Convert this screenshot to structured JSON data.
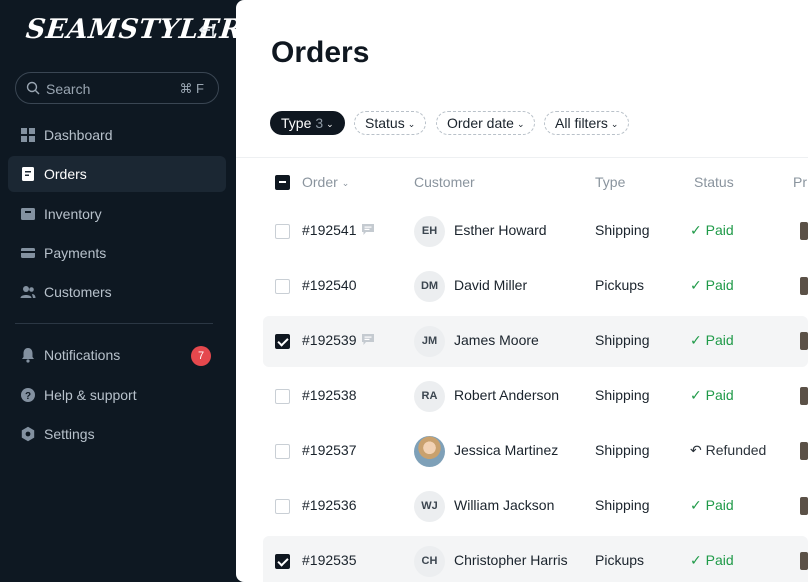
{
  "brand": {
    "logo": "SEAMSTYLERS"
  },
  "search": {
    "placeholder": "Search",
    "shortcut": "⌘ F"
  },
  "sidebar": {
    "items": [
      {
        "label": "Dashboard",
        "icon": "grid-icon"
      },
      {
        "label": "Orders",
        "icon": "receipt-icon",
        "active": true
      },
      {
        "label": "Inventory",
        "icon": "box-icon"
      },
      {
        "label": "Payments",
        "icon": "card-icon"
      },
      {
        "label": "Customers",
        "icon": "users-icon"
      }
    ],
    "secondary": [
      {
        "label": "Notifications",
        "icon": "bell-icon",
        "badge": "7"
      },
      {
        "label": "Help & support",
        "icon": "help-icon"
      },
      {
        "label": "Settings",
        "icon": "gear-icon"
      }
    ]
  },
  "main": {
    "title": "Orders",
    "filters": {
      "type": {
        "label": "Type",
        "count": "3"
      },
      "status": "Status",
      "order_date": "Order date",
      "all": "All filters"
    },
    "columns": {
      "order": "Order",
      "customer": "Customer",
      "type": "Type",
      "status": "Status",
      "extra": "Pr"
    },
    "rows": [
      {
        "id": "#192541",
        "initials": "EH",
        "name": "Esther Howard",
        "type": "Shipping",
        "status": "Paid",
        "status_icon": "✓",
        "checked": false,
        "has_note": true,
        "selected": false
      },
      {
        "id": "#192540",
        "initials": "DM",
        "name": "David Miller",
        "type": "Pickups",
        "status": "Paid",
        "status_icon": "✓",
        "checked": false,
        "has_note": false,
        "selected": false
      },
      {
        "id": "#192539",
        "initials": "JM",
        "name": "James Moore",
        "type": "Shipping",
        "status": "Paid",
        "status_icon": "✓",
        "checked": true,
        "has_note": true,
        "selected": true
      },
      {
        "id": "#192538",
        "initials": "RA",
        "name": "Robert Anderson",
        "type": "Shipping",
        "status": "Paid",
        "status_icon": "✓",
        "checked": false,
        "has_note": false,
        "selected": false
      },
      {
        "id": "#192537",
        "initials": "",
        "name": "Jessica Martinez",
        "type": "Shipping",
        "status": "Refunded",
        "status_icon": "↶",
        "checked": false,
        "has_note": false,
        "selected": false,
        "photo": true
      },
      {
        "id": "#192536",
        "initials": "WJ",
        "name": "William Jackson",
        "type": "Shipping",
        "status": "Paid",
        "status_icon": "✓",
        "checked": false,
        "has_note": false,
        "selected": false
      },
      {
        "id": "#192535",
        "initials": "CH",
        "name": "Christopher Harris",
        "type": "Pickups",
        "status": "Paid",
        "status_icon": "✓",
        "checked": true,
        "has_note": false,
        "selected": true
      }
    ]
  },
  "colors": {
    "sidebar_bg": "#0e1822",
    "paid": "#1f9a48",
    "badge": "#e5484d"
  }
}
